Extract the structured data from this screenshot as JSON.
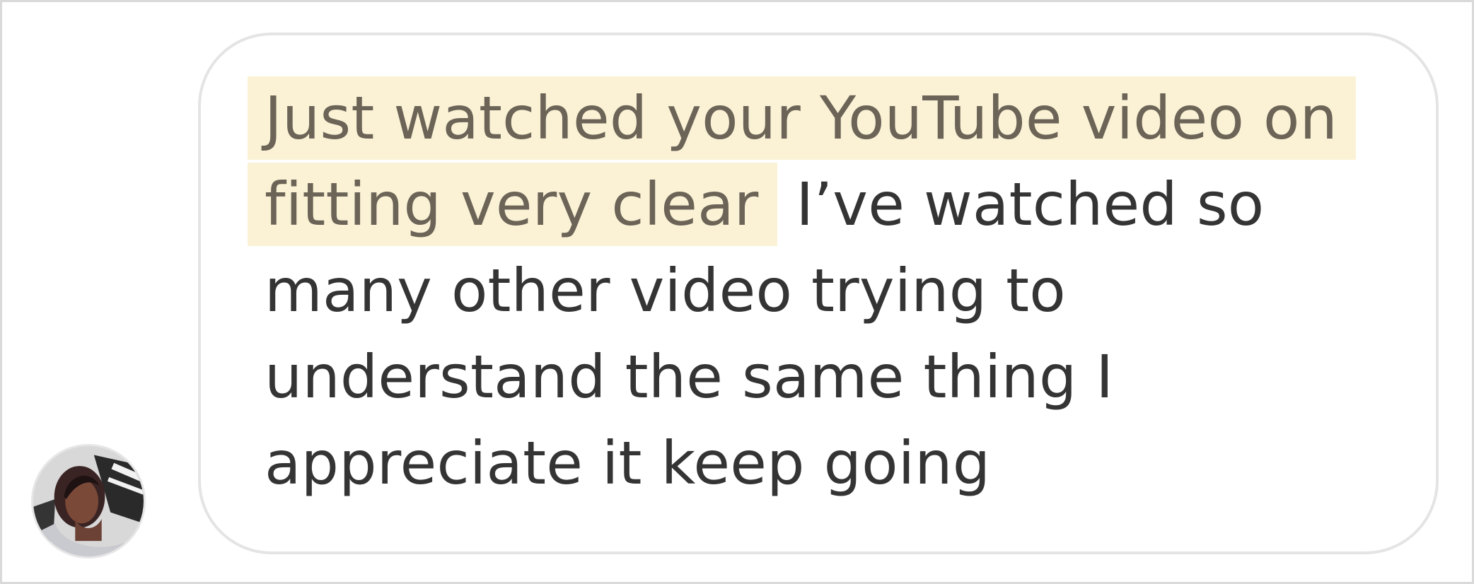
{
  "message": {
    "highlighted_text": "Just watched your YouTube video on fitting very clear",
    "rest_text": " I’ve watched so many other video trying to understand the same thing I appreciate it keep going"
  },
  "colors": {
    "highlight_background": "#fbf2d6",
    "text_main": "#343434",
    "highlight_text": "#6b6457",
    "bubble_border": "#e4e4e4"
  },
  "icons": {
    "avatar": "profile-photo"
  }
}
